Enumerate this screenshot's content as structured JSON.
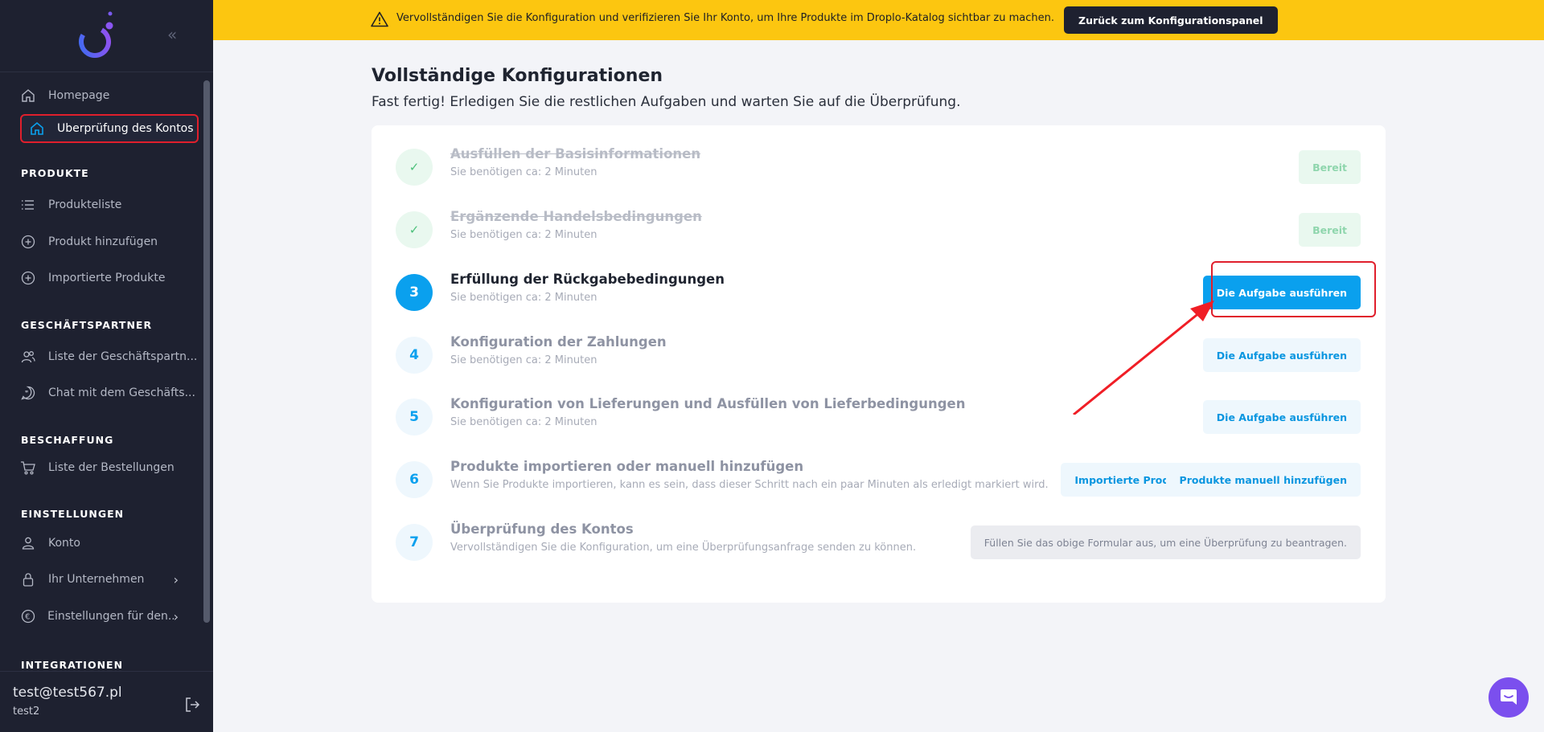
{
  "banner": {
    "text": "Vervollständigen Sie die Konfiguration und verifizieren Sie Ihr Konto, um Ihre Produkte im Droplo-Katalog sichtbar zu machen.",
    "button": "Zurück zum Konfigurationspanel"
  },
  "sidebar": {
    "items": {
      "homepage": "Homepage",
      "account_review": "Überprüfung des Kontos"
    },
    "sections": {
      "products": "PRODUKTE",
      "partners": "GESCHÄFTSPARTNER",
      "procurement": "BESCHAFFUNG",
      "settings": "EINSTELLUNGEN",
      "integrations": "INTEGRATIONEN"
    },
    "products": {
      "list": "Produkteliste",
      "add": "Produkt hinzufügen",
      "imported": "Importierte Produkte"
    },
    "partners": {
      "list": "Liste der Geschäftspartn...",
      "chat": "Chat mit dem Geschäfts..."
    },
    "procurement": {
      "orders": "Liste der Bestellungen"
    },
    "settings": {
      "account": "Konto",
      "company": "Ihr Unternehmen",
      "settings_for": "Einstellungen für den..."
    },
    "user": {
      "email": "test@test567.pl",
      "name": "test2"
    }
  },
  "main": {
    "title": "Vollständige Konfigurationen",
    "subtitle": "Fast fertig! Erledigen Sie die restlichen Aufgaben und warten Sie auf die Überprüfung."
  },
  "tasks": [
    {
      "badge": "✓",
      "title": "Ausfüllen der Basisinformationen",
      "sub": "Sie benötigen ca: 2 Minuten",
      "button": "Bereit"
    },
    {
      "badge": "✓",
      "title": "Ergänzende Handelsbedingungen",
      "sub": "Sie benötigen ca: 2 Minuten",
      "button": "Bereit"
    },
    {
      "badge": "3",
      "title": "Erfüllung der Rückgabebedingungen",
      "sub": "Sie benötigen ca: 2 Minuten",
      "button": "Die Aufgabe ausführen"
    },
    {
      "badge": "4",
      "title": "Konfiguration der Zahlungen",
      "sub": "Sie benötigen ca: 2 Minuten",
      "button": "Die Aufgabe ausführen"
    },
    {
      "badge": "5",
      "title": "Konfiguration von Lieferungen und Ausfüllen von Lieferbedingungen",
      "sub": "Sie benötigen ca: 2 Minuten",
      "button": "Die Aufgabe ausführen"
    },
    {
      "badge": "6",
      "title": "Produkte importieren oder manuell hinzufügen",
      "sub": "Wenn Sie Produkte importieren, kann es sein, dass dieser Schritt nach ein paar Minuten als erledigt markiert wird.",
      "button": "Importierte Produkte",
      "button2": "Produkte manuell hinzufügen"
    },
    {
      "badge": "7",
      "title": "Überprüfung des Kontos",
      "sub": "Vervollständigen Sie die Konfiguration, um eine Überprüfungsanfrage senden zu können.",
      "button": "Füllen Sie das obige Formular aus, um eine Überprüfung zu beantragen."
    }
  ],
  "colors": {
    "banner": "#fcc610",
    "sidebar": "#1e2130",
    "primary": "#0aa0ee",
    "highlight": "#e01f2c",
    "chat": "#7b4fee"
  }
}
